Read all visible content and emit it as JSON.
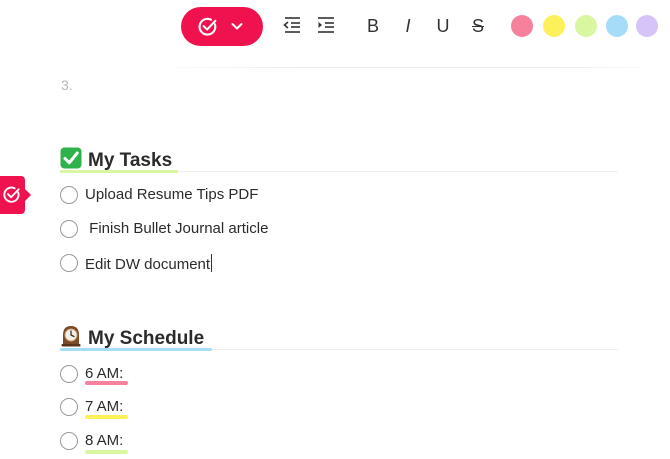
{
  "toolbar": {
    "mode_icon": "check-circle-icon",
    "mode_dropdown_icon": "chevron-down-icon",
    "indent_less_icon": "indent-decrease-icon",
    "indent_more_icon": "indent-increase-icon",
    "bold_label": "B",
    "italic_label": "I",
    "underline_label": "U",
    "strike_label": "S",
    "colors": [
      "#f7819c",
      "#fcf15a",
      "#d8f7a0",
      "#a5dcf7",
      "#d6c3f7"
    ],
    "accent": "#f0124f"
  },
  "content": {
    "list_number": "3.",
    "tasks_heading": {
      "emoji": "check-mark-button-icon",
      "text": "My Tasks",
      "underline_color": "#d8f7a0"
    },
    "tasks": [
      {
        "label": "Upload Resume Tips PDF",
        "checked": false
      },
      {
        "label": " Finish Bullet Journal article",
        "checked": false
      },
      {
        "label": "Edit DW document",
        "checked": false
      }
    ],
    "schedule_heading": {
      "emoji": "mantelpiece-clock-icon",
      "text": "My Schedule",
      "underline_color": "#a5dcf7"
    },
    "schedule": [
      {
        "label": "6 AM:",
        "highlight": "#f7819c"
      },
      {
        "label": "7 AM:",
        "highlight": "#fcf15a"
      },
      {
        "label": "8 AM:",
        "highlight": "#d8f7a0"
      }
    ]
  },
  "side_tab": {
    "icon": "check-circle-icon"
  }
}
